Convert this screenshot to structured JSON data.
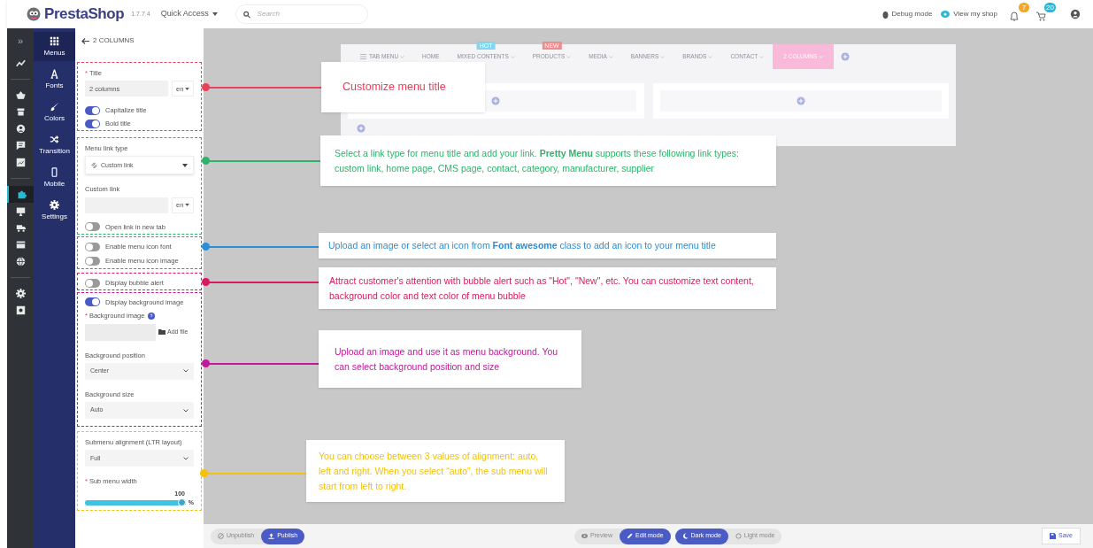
{
  "header": {
    "logo": "PrestaShop",
    "version": "1.7.7.4",
    "quick_access": "Quick Access",
    "search": {
      "placeholder": "Search"
    },
    "links": [
      {
        "kind": "debug",
        "label": "Debug mode"
      },
      {
        "kind": "view",
        "label": "View my shop"
      }
    ],
    "notifications": [
      {
        "kind": "bell",
        "count": "7"
      },
      {
        "kind": "cart",
        "count": "20"
      }
    ]
  },
  "rail": {
    "toggle": "»",
    "items": [
      {
        "kind": "stats",
        "selected": false
      },
      {
        "kind": "divider"
      },
      {
        "kind": "basket",
        "selected": false
      },
      {
        "kind": "store",
        "selected": false
      },
      {
        "kind": "user",
        "selected": false
      },
      {
        "kind": "message",
        "selected": false
      },
      {
        "kind": "chart",
        "selected": false
      },
      {
        "kind": "divider"
      },
      {
        "kind": "puzzle",
        "selected": true
      },
      {
        "kind": "monitor",
        "selected": false
      },
      {
        "kind": "truck",
        "selected": false
      },
      {
        "kind": "card",
        "selected": false
      },
      {
        "kind": "globe",
        "selected": false
      },
      {
        "kind": "divider"
      },
      {
        "kind": "gear",
        "selected": false
      },
      {
        "kind": "box",
        "selected": false
      }
    ]
  },
  "nav": [
    {
      "kind": "grid",
      "label": "Menus",
      "selected": true
    },
    {
      "kind": "font",
      "label": "Fonts",
      "selected": false
    },
    {
      "kind": "brush",
      "label": "Colors",
      "selected": false
    },
    {
      "kind": "shuffle",
      "label": "Transition",
      "selected": false
    },
    {
      "kind": "mobile",
      "label": "Mobile",
      "selected": false
    },
    {
      "kind": "gear",
      "label": "Settings",
      "selected": false
    }
  ],
  "form": {
    "back_title": "2 COLUMNS",
    "groups": [
      {
        "color": "#e8415a",
        "callout": "Customize menu title",
        "fields": [
          {
            "kind": "text",
            "marker": "*",
            "label": "Title",
            "value": "2 columns",
            "lang": "en"
          },
          {
            "kind": "toggle",
            "label": "Capitalize title",
            "on": true
          },
          {
            "kind": "toggle",
            "label": "Bold title",
            "on": true
          }
        ]
      },
      {
        "color": "#2fb36a",
        "callout": "Select a link type for menu title and add your link. **Pretty Menu** supports these following link types: custom link, home page, CMS page, contact, category, manufacturer, supplier",
        "fields": [
          {
            "kind": "select",
            "label": "Menu link type",
            "value": "Custom link",
            "link_icon": true
          },
          {
            "kind": "text",
            "label": "Custom link",
            "lang": "en"
          },
          {
            "kind": "toggle",
            "label": "Open link in new tab",
            "on": false
          }
        ]
      },
      {
        "color": "#2a8fd6",
        "callout": "Upload an image or select an icon from **Font awesome** class to add an icon to your menu title",
        "fields": [
          {
            "kind": "toggle",
            "label": "Enable menu icon font",
            "on": false
          },
          {
            "kind": "toggle",
            "label": "Enable menu icon image",
            "on": false
          }
        ]
      },
      {
        "color": "#d81b60",
        "callout": "Attract customer's attention with bubble alert such as \"Hot\", \"New\", etc. You can customize text content, background color and text color of menu bubble",
        "fields": [
          {
            "kind": "toggle",
            "label": "Display bubble alert",
            "on": false
          }
        ]
      },
      {
        "color": "#c2189b",
        "callout": "Upload an image and use it as menu background. You can select background position and size",
        "fields": [
          {
            "kind": "toggle",
            "label": "Display background image",
            "on": true
          },
          {
            "kind": "file",
            "marker": "*",
            "label": "Background image",
            "button": "Add file"
          },
          {
            "kind": "select",
            "label": "Background position",
            "value": "Center",
            "link_icon": false
          },
          {
            "kind": "select",
            "label": "Background size",
            "value": "Auto",
            "link_icon": false
          }
        ]
      },
      {
        "color": "#f4c20d",
        "callout": "You can choose between 3 values of alignment: auto, left and right. When you select “auto”, the sub menu will start from left to right.",
        "fields": [
          {
            "kind": "select",
            "label": "Submenu alignment (LTR layout)",
            "value": "Full",
            "link_icon": false
          },
          {
            "kind": "slider",
            "marker": "*",
            "label": "Sub menu width",
            "reading": "100",
            "unit": "%",
            "level": 1
          }
        ]
      }
    ]
  },
  "preview": {
    "tabs": [
      {
        "kind": "menu",
        "label": "TAB MENU",
        "caret": true,
        "selected": false
      },
      {
        "kind": "plain",
        "label": "HOME",
        "caret": false,
        "selected": false
      },
      {
        "kind": "plain",
        "label": "MIXED CONTENTS",
        "caret": true,
        "selected": false,
        "badge": {
          "text": "HOT",
          "color": "#7fd6f2"
        }
      },
      {
        "kind": "plain",
        "label": "PRODUCTS",
        "caret": true,
        "selected": false,
        "badge": {
          "text": "NEW",
          "color": "#f28b8b"
        }
      },
      {
        "kind": "plain",
        "label": "MEDIA",
        "caret": true,
        "selected": false
      },
      {
        "kind": "plain",
        "label": "BANNERS",
        "caret": true,
        "selected": false
      },
      {
        "kind": "plain",
        "label": "BRANDS",
        "caret": true,
        "selected": false
      },
      {
        "kind": "plain",
        "label": "CONTACT",
        "caret": true,
        "selected": false
      },
      {
        "kind": "plain",
        "label": "2 COLUMNS",
        "caret": true,
        "selected": true
      }
    ],
    "columns": [
      {
        "kind": "empty"
      },
      {
        "kind": "empty"
      }
    ]
  },
  "bottom_bar": {
    "publish": [
      {
        "kind": "unpublish",
        "label": "Unpublish",
        "selected": false
      },
      {
        "kind": "publish",
        "label": "Publish",
        "selected": true
      }
    ],
    "mode": [
      {
        "kind": "preview",
        "label": "Preview",
        "selected": false
      },
      {
        "kind": "edit",
        "label": "Edit mode",
        "selected": true
      }
    ],
    "theme": [
      {
        "kind": "dark",
        "label": "Dark mode",
        "selected": true
      },
      {
        "kind": "light",
        "label": "Light mode",
        "selected": false
      }
    ],
    "save": "Save"
  }
}
